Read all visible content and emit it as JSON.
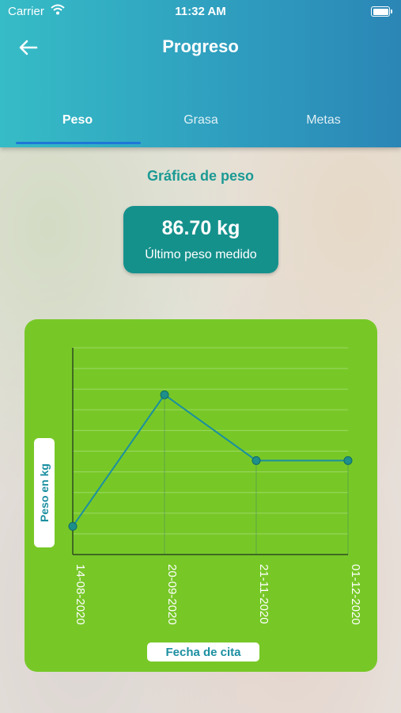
{
  "status_bar": {
    "carrier": "Carrier",
    "time": "11:32 AM"
  },
  "header": {
    "title": "Progreso"
  },
  "tabs": [
    {
      "label": "Peso",
      "active": true
    },
    {
      "label": "Grasa",
      "active": false
    },
    {
      "label": "Metas",
      "active": false
    }
  ],
  "section_title": "Gráfica de peso",
  "last_weight": {
    "value": "86.70 kg",
    "label": "Último peso medido"
  },
  "colors": {
    "header_start": "#36bcc6",
    "header_end": "#2b86b6",
    "accent": "#15918c",
    "chart_bg": "#77c827",
    "line": "#1b8fa0",
    "tab_indicator": "#1e78d6"
  },
  "icons": {
    "back": "back-arrow-icon",
    "wifi": "wifi-icon",
    "battery": "battery-icon"
  },
  "chart_data": {
    "type": "line",
    "xlabel": "Fecha de cita",
    "ylabel": "Peso en kg",
    "categories": [
      "14-08-2020",
      "20-09-2020",
      "21-11-2020",
      "01-12-2020"
    ],
    "series": [
      {
        "values": [
          86.0,
          93.0,
          89.5,
          89.5
        ]
      }
    ],
    "ylim": [
      84.5,
      95.5
    ],
    "grid": true
  }
}
